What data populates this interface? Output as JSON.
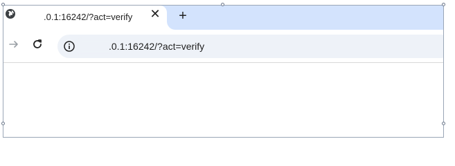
{
  "tab": {
    "title": ".0.1:16242/?act=verify",
    "close_icon": "close-icon",
    "favicon": "globe-icon"
  },
  "tabstrip": {
    "new_tab_label": "+"
  },
  "toolbar": {
    "back_icon": "arrow-forward-icon",
    "reload_icon": "reload-icon",
    "site_info_icon": "info-icon"
  },
  "omnibox": {
    "url": ".0.1:16242/?act=verify"
  },
  "colors": {
    "tabstrip_bg": "#d3e3fd",
    "omnibox_bg": "#eef2f8",
    "text": "#1f1f1f"
  }
}
